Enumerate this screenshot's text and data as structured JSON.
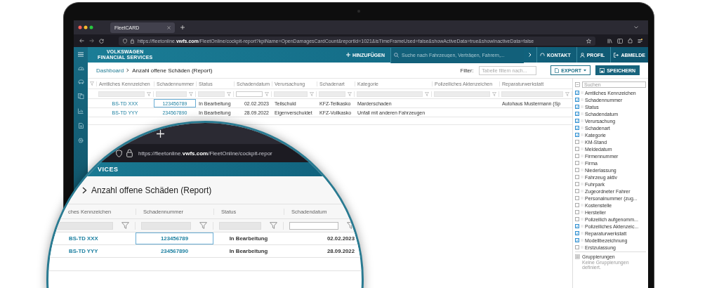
{
  "browser": {
    "tab_title": "FleetCARD",
    "url": "https://fleetonline.**vwfs.com**/FleetOnline/cockpit-report?kpiName=OpenDamagesCardCount&reportId=1021&isTimeFrameUsed=false&showActiveData=true&showInactiveData=false"
  },
  "header": {
    "logo": [
      "VOLKSWAGEN",
      "FINANCIAL SERVICES"
    ],
    "add_button": "HINZUFÜGEN",
    "search": {
      "placeholder": "Suche nach Fahrzeugen, Verträgen, Fahrern,..."
    },
    "actions": [
      {
        "kind": "contact",
        "label": "KONTAKT"
      },
      {
        "kind": "profile",
        "label": "PROFIL"
      },
      {
        "kind": "logout",
        "label": "ABMELDE"
      }
    ]
  },
  "breadcrumb": {
    "parent": "Dashboard",
    "current": "Anzahl offene Schäden (Report)"
  },
  "toolbar": {
    "filter_label": "Filter:",
    "filter": {
      "placeholder": "Tabelle filtern nach..."
    },
    "export": "EXPORT",
    "save": "SPEICHERN"
  },
  "table": {
    "columns": [
      {
        "label": "Amtliches Kennzeichen",
        "kind": "link"
      },
      {
        "label": "Schadennummer",
        "kind": "link"
      },
      {
        "label": "Status",
        "kind": "text"
      },
      {
        "label": "Schadendatum",
        "kind": "date"
      },
      {
        "label": "Verursachung",
        "kind": "text"
      },
      {
        "label": "Schadenart",
        "kind": "text"
      },
      {
        "label": "Kategorie",
        "kind": "text"
      },
      {
        "label": "Polizeiliches Aktenzeichen",
        "kind": "text"
      },
      {
        "label": "Reparaturwerkstatt",
        "kind": "text"
      }
    ],
    "rows": [
      {
        "cells": [
          {
            "text": "BS-TD XXX",
            "focused": false
          },
          {
            "text": "123456789",
            "focused": true
          },
          {
            "text": "In Bearbeitung",
            "focused": false
          },
          {
            "text": "02.02.2023",
            "focused": false
          },
          {
            "text": "Teilschuld",
            "focused": false
          },
          {
            "text": "KFZ-Teilkasko",
            "focused": false
          },
          {
            "text": "Marderschaden",
            "focused": false
          },
          null,
          {
            "text": "Autohaus Mustermann (Sp",
            "focused": false
          }
        ]
      },
      {
        "cells": [
          {
            "text": "BS-TD YYY",
            "focused": false
          },
          {
            "text": "234567890",
            "focused": false
          },
          {
            "text": "In Bearbeitung",
            "focused": false
          },
          {
            "text": "28.09.2022",
            "focused": false
          },
          {
            "text": "Eigenverschuldet",
            "focused": false
          },
          {
            "text": "KFZ-Vollkasko",
            "focused": false
          },
          {
            "text": "Unfall mit anderen Fahrzeugen",
            "focused": false
          },
          null,
          null
        ]
      }
    ]
  },
  "column_panel": {
    "search": {
      "placeholder": "Suchen"
    },
    "columns": [
      {
        "label": "Amtliches Kennzeichen",
        "checked": true
      },
      {
        "label": "Schadennummer",
        "checked": true
      },
      {
        "label": "Status",
        "checked": true
      },
      {
        "label": "Schadendatum",
        "checked": true
      },
      {
        "label": "Verursachung",
        "checked": true
      },
      {
        "label": "Schadenart",
        "checked": true
      },
      {
        "label": "Kategorie",
        "checked": true
      },
      {
        "label": "KM-Stand",
        "checked": false
      },
      {
        "label": "Meldedatum",
        "checked": false
      },
      {
        "label": "Firmennummer",
        "checked": false
      },
      {
        "label": "Firma",
        "checked": false
      },
      {
        "label": "Niederlassung",
        "checked": false
      },
      {
        "label": "Fahrzeug aktiv",
        "checked": false
      },
      {
        "label": "Fuhrpark",
        "checked": false
      },
      {
        "label": "Zugeordneter Fahrer",
        "checked": false
      },
      {
        "label": "Personalnummer (zug...",
        "checked": false
      },
      {
        "label": "Kostenstelle",
        "checked": false
      },
      {
        "label": "Hersteller",
        "checked": false
      },
      {
        "label": "Polizeilich aufgenomm...",
        "checked": false
      },
      {
        "label": "Polizeiliches Aktenzeic...",
        "checked": true
      },
      {
        "label": "Reparaturwerkstatt",
        "checked": true
      },
      {
        "label": "Modellbezeichnung",
        "checked": true
      },
      {
        "label": "Erstzulassung",
        "checked": false
      }
    ],
    "grouping": {
      "title": "Gruppierungen",
      "empty_text": "Keine Gruppierungen definiert."
    }
  },
  "magnifier": {
    "url": "https://fleetonline.**vwfs.com**/FleetOnline/cockpit-repor",
    "logo": "VICES",
    "title": "Anzahl offene Schäden (Report)",
    "columns": [
      {
        "label": "ches Kennzeichen",
        "kind": "link"
      },
      {
        "label": "Schadennummer",
        "kind": "link"
      },
      {
        "label": "Status",
        "kind": "text"
      },
      {
        "label": "Schadendatum",
        "kind": "date"
      }
    ],
    "rows": [
      {
        "cells": [
          {
            "text": "BS-TD XXX",
            "focused": false
          },
          {
            "text": "123456789",
            "focused": true
          },
          {
            "text": "In Bearbeitung",
            "focused": false
          },
          {
            "text": "02.02.2023",
            "focused": false
          }
        ]
      },
      {
        "cells": [
          {
            "text": "BS-TD YYY",
            "focused": false
          },
          {
            "text": "234567890",
            "focused": false
          },
          {
            "text": "In Bearbeitung",
            "focused": false
          },
          {
            "text": "28.09.2022",
            "focused": false
          }
        ]
      }
    ]
  }
}
